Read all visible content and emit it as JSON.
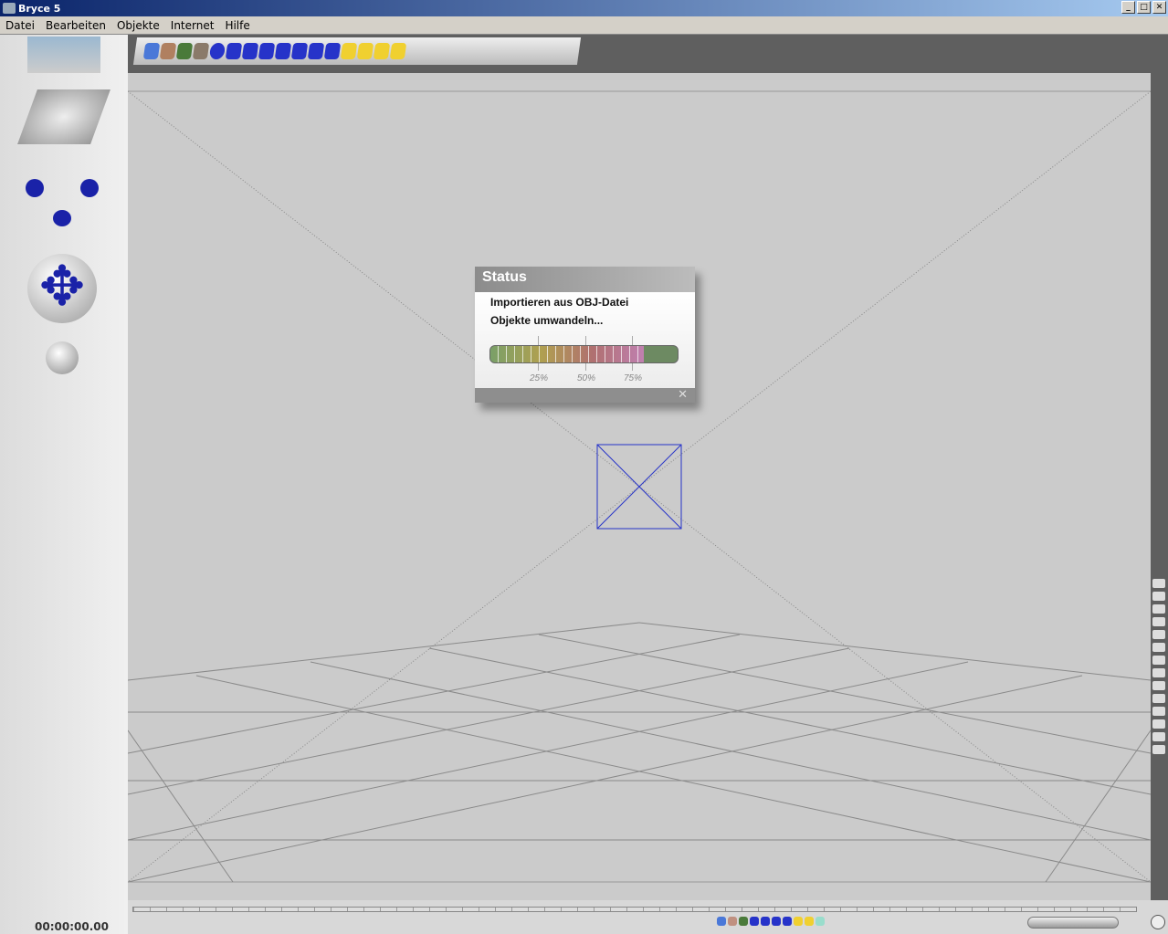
{
  "window": {
    "title": "Bryce 5",
    "controls": [
      "_",
      "□",
      "✕"
    ]
  },
  "menu": [
    "Datei",
    "Bearbeiten",
    "Objekte",
    "Internet",
    "Hilfe"
  ],
  "status_dialog": {
    "title": "Status",
    "line1": "Importieren aus OBJ-Datei",
    "line2": "Objekte umwandeln...",
    "progress_percent": 82,
    "ticks": [
      "25%",
      "50%",
      "75%"
    ],
    "close": "✕"
  },
  "timeline": {
    "time": "00:00:00.00"
  },
  "colors": {
    "accent": "#2633c9",
    "viewport": "#cbcbcb"
  }
}
